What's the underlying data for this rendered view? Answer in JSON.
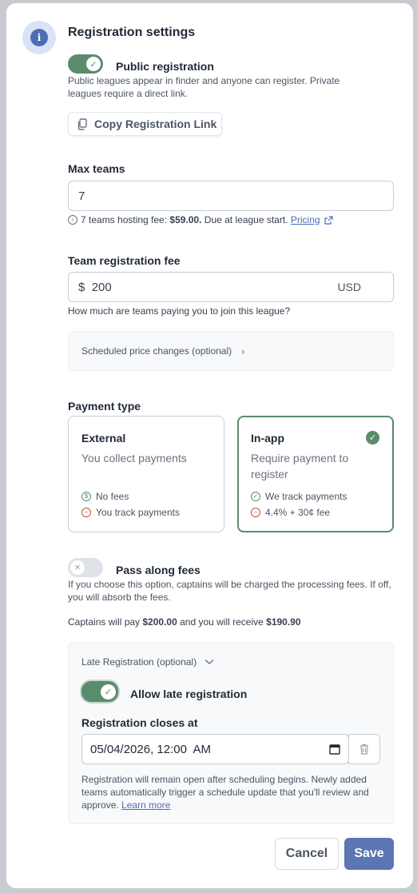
{
  "header": {
    "title": "Registration settings",
    "icon": "info-icon"
  },
  "public_registration": {
    "label": "Public registration",
    "enabled": true,
    "description": "Public leagues appear in finder and anyone can register. Private leagues require a direct link.",
    "copy_button_label": "Copy Registration Link"
  },
  "max_teams": {
    "label": "Max teams",
    "value": "7",
    "hint_prefix": "7 teams hosting fee: ",
    "hint_fee": "$59.00.",
    "hint_suffix": " Due at league start. ",
    "pricing_link": "Pricing"
  },
  "team_fee": {
    "label": "Team registration fee",
    "currency_symbol": "$",
    "value": "200",
    "currency_code": "USD",
    "hint": "How much are teams paying you to join this league?",
    "scheduled_label": "Scheduled price changes (optional)"
  },
  "payment_type": {
    "label": "Payment type",
    "external": {
      "title": "External",
      "description": "You collect payments",
      "feature_1": "No fees",
      "feature_2": "You track payments"
    },
    "inapp": {
      "title": "In-app",
      "description": "Require payment to register",
      "feature_1": "We track payments",
      "feature_2": "4.4% + 30¢ fee",
      "selected": true
    }
  },
  "pass_fees": {
    "label": "Pass along fees",
    "enabled": false,
    "description": "If you choose this option, captains will be charged the processing fees. If off, you will absorb the fees.",
    "summary_1": "Captains will pay ",
    "captains_pay": "$200.00",
    "summary_2": " and you will receive ",
    "you_receive": "$190.90"
  },
  "late_registration": {
    "section_label": "Late Registration (optional)",
    "toggle_label": "Allow late registration",
    "enabled": true,
    "closes_label": "Registration closes at",
    "closes_value": "05/04/2026, 12:00  AM",
    "note": "Registration will remain open after scheduling begins. Newly added teams automatically trigger a schedule update that you'll review and approve. ",
    "learn_more": "Learn more"
  },
  "footer": {
    "cancel_label": "Cancel",
    "save_label": "Save"
  },
  "colors": {
    "accent_green": "#5a8b6d",
    "primary_blue": "#5a76b3",
    "info_badge": "#d9e3f7"
  }
}
